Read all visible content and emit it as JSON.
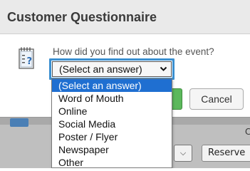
{
  "dialog": {
    "title": "Customer Questionnaire",
    "question": "How did you find out about the event?",
    "select_value": "(Select an answer)",
    "cancel_label": "Cancel"
  },
  "dropdown": {
    "options": [
      "(Select an answer)",
      "Word of Mouth",
      "Online",
      "Social Media",
      "Poster / Flyer",
      "Newspaper",
      "Other"
    ],
    "selected_index": 0
  },
  "background": {
    "partial_letter": "C",
    "reserve_label": "Reserve"
  },
  "colors": {
    "focus_ring": "#3a8fd0",
    "selected_option": "#1f6fd1",
    "ok_button": "#5cb85c"
  }
}
